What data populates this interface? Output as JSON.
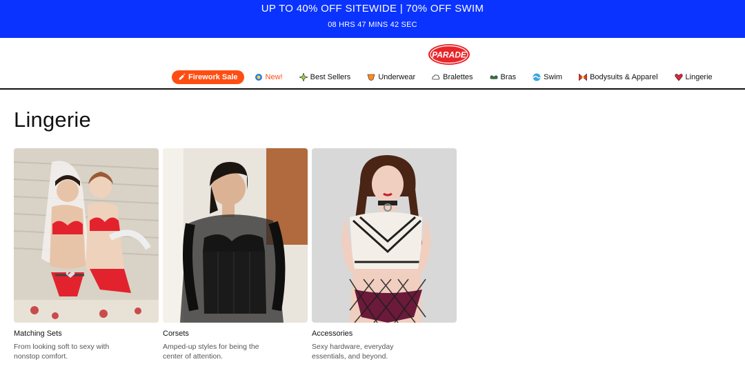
{
  "promo": {
    "headline": "UP TO 40% OFF SITEWIDE | 70% OFF SWIM",
    "countdown": "08 HRS  47 MINS  42 SEC",
    "background": "#0a33ff"
  },
  "header": {
    "logo_text": "PARADE",
    "logo_color": "#e8262a",
    "nav": [
      {
        "label": "Firework Sale",
        "icon": "firecracker-icon",
        "accent": "#ff4d12"
      },
      {
        "label": "New!",
        "icon": "sparkle-badge-icon"
      },
      {
        "label": "Best Sellers",
        "icon": "star-burst-icon"
      },
      {
        "label": "Underwear",
        "icon": "peach-icon"
      },
      {
        "label": "Bralettes",
        "icon": "cloud-icon"
      },
      {
        "label": "Bras",
        "icon": "bra-icon"
      },
      {
        "label": "Swim",
        "icon": "wave-icon"
      },
      {
        "label": "Bodysuits & Apparel",
        "icon": "bow-icon"
      },
      {
        "label": "Lingerie",
        "icon": "heart-lips-icon"
      }
    ]
  },
  "main": {
    "title": "Lingerie",
    "categories": [
      {
        "title": "Matching Sets",
        "description": "From looking soft to sexy with nonstop comfort.",
        "image": "matching-sets-photo"
      },
      {
        "title": "Corsets",
        "description": "Amped-up styles for being the center of attention.",
        "image": "corsets-photo"
      },
      {
        "title": "Accessories",
        "description": "Sexy hardware, everyday essentials, and beyond.",
        "image": "accessories-photo"
      }
    ]
  }
}
